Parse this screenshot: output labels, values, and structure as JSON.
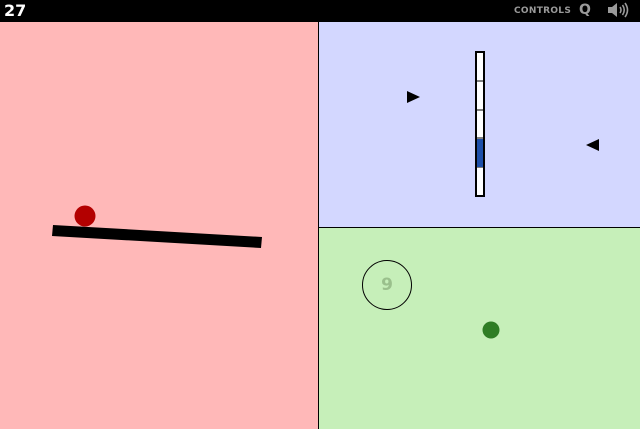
{
  "hud": {
    "score": "27",
    "controls_label": "CONTROLS",
    "quit_label": "Q",
    "sound_icon": "speaker-icon"
  },
  "red_panel": {
    "color": "#ffb8b8",
    "ball_color": "#b30000"
  },
  "blue_panel": {
    "color": "#d3d7ff",
    "meter_segments": 5,
    "meter_active_segment": 4,
    "meter_active_color": "#1e4fa8"
  },
  "green_panel": {
    "color": "#c6efb9",
    "ring_number": "9",
    "ball_color": "#2f7d25"
  }
}
